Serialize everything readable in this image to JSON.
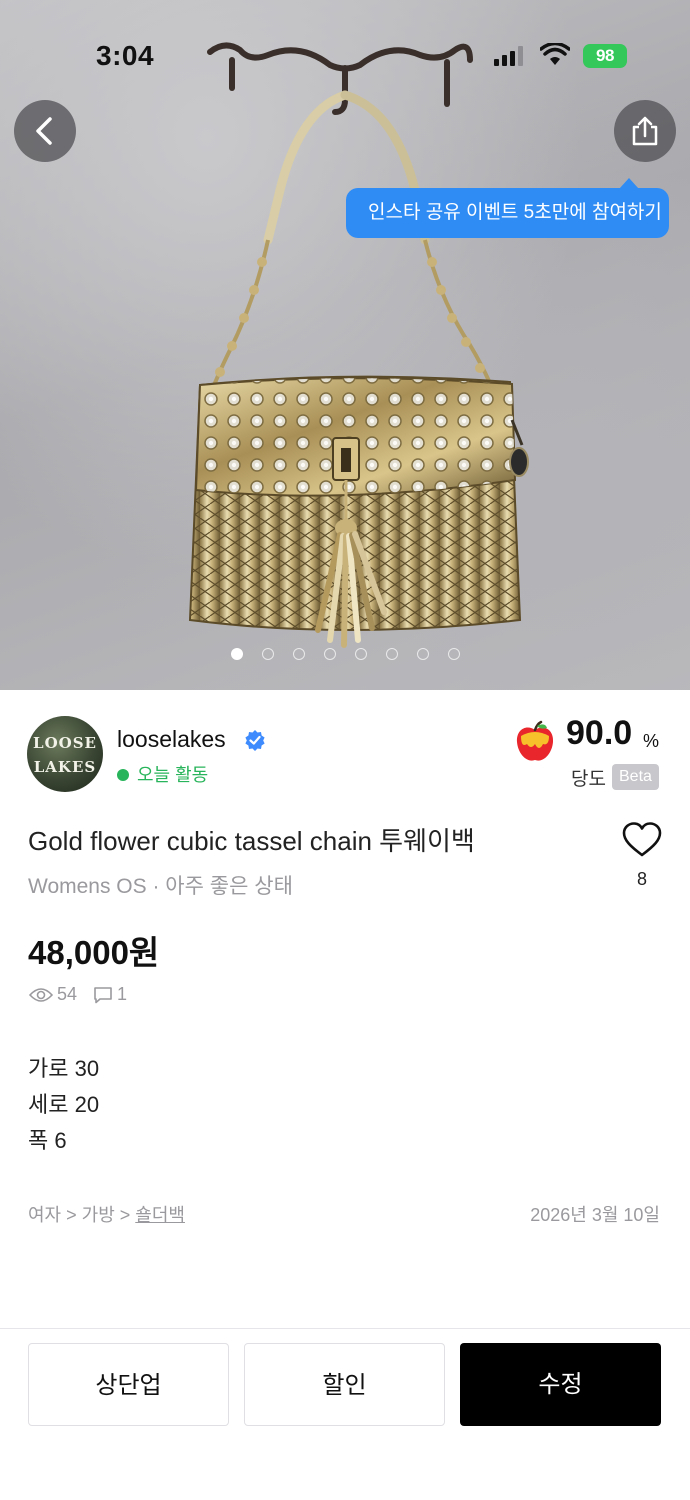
{
  "status_bar": {
    "time": "3:04",
    "battery": "98"
  },
  "hero": {
    "image_alt": "Gold flower cubic tassel chain bag photo",
    "tooltip": "인스타 공유 이벤트 5초만에 참여하기",
    "page_count": 8,
    "current_page": 1
  },
  "seller": {
    "avatar_text_top": "LOOSE",
    "avatar_text_bottom": "LAKES",
    "name": "looselakes",
    "activity": "오늘 활동",
    "score": "90.0",
    "score_unit": "%",
    "score_label": "당도",
    "beta_badge": "Beta"
  },
  "product": {
    "title": "Gold flower cubic tassel chain 투웨이백",
    "subtitle": "Womens OS · 아주 좋은 상태",
    "likes": "8",
    "price": "48,000원",
    "views": "54",
    "comments": "1",
    "description": [
      "가로 30",
      "세로 20",
      "폭 6"
    ],
    "breadcrumb_prefix": "여자 > 가방 > ",
    "breadcrumb_leaf": "숄더백",
    "date": "2026년 3월 10일"
  },
  "actions": {
    "bump": "상단업",
    "discount": "할인",
    "edit": "수정"
  },
  "colors": {
    "accent_blue": "#2f8cf5",
    "active_green": "#28b45a",
    "battery_green": "#34c759"
  }
}
